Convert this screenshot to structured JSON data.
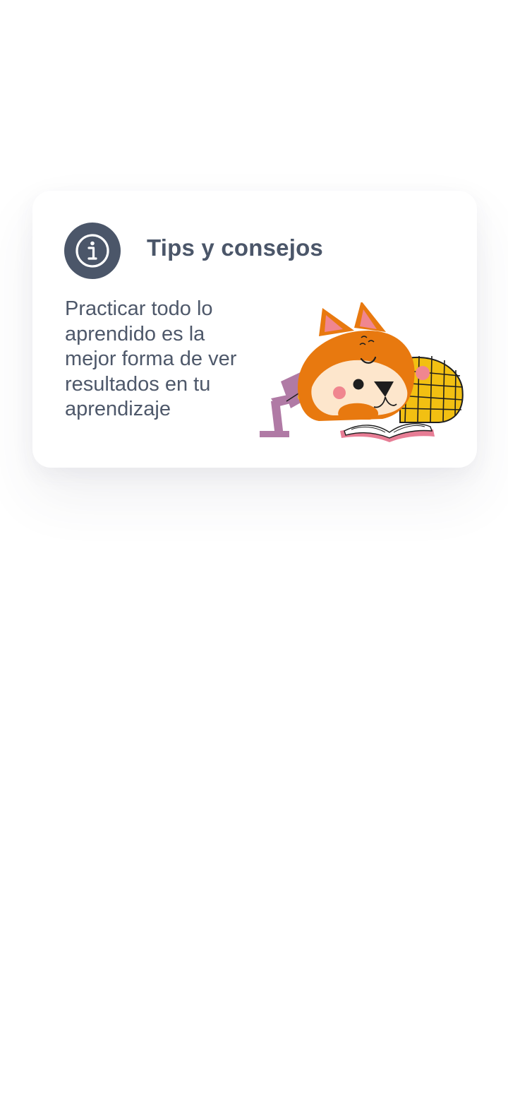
{
  "tip_card": {
    "icon": "info-icon",
    "title": "Tips y consejos",
    "body": "Practicar todo lo aprendido es la mejor forma de ver resultados en tu aprendizaje",
    "illustration": "sleeping-fox-reading-illustration"
  },
  "colors": {
    "background": "#ffffff",
    "icon_badge": "#4b5669",
    "title_text": "#4b5669",
    "body_text": "#4e586a",
    "fox_orange": "#e8790f",
    "fox_cream": "#fde6cc",
    "cheek_pink": "#f0868f",
    "lamp_purple": "#b07aa5",
    "blanket_yellow": "#f2c012",
    "book_pink": "#e77d95"
  }
}
